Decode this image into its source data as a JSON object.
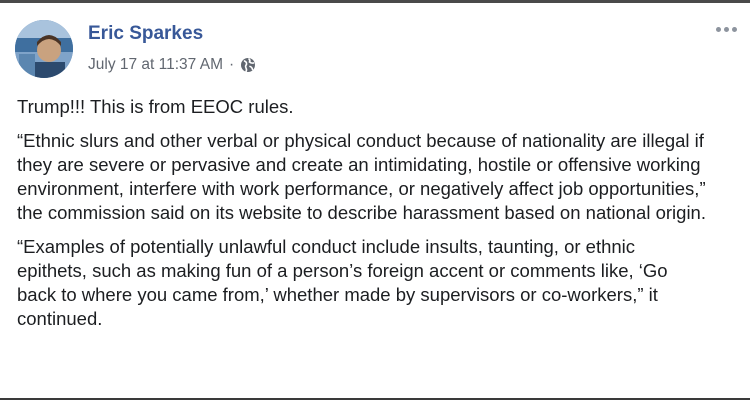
{
  "post": {
    "author": "Eric Sparkes",
    "timestamp": "July 17 at 11:37 AM",
    "separator": "·",
    "privacy_icon": "globe-icon",
    "more_icon": "more-options-icon",
    "paragraphs": [
      "Trump!!! This is from EEOC rules.",
      "“Ethnic slurs and other verbal or physical conduct because of nationality are illegal if they are severe or pervasive and create an intimidating, hostile or offensive working environment, interfere with work performance, or negatively affect job opportunities,” the commission said on its website to describe harassment based on national origin.",
      "“Examples of potentially unlawful conduct include insults, taunting, or ethnic epithets, such as making fun of a person’s foreign accent or comments like, ‘Go back to where you came from,’ whether made by supervisors or co-workers,” it continued."
    ]
  },
  "colors": {
    "author_link": "#385898",
    "meta_text": "#616770",
    "body_text": "#1c1e21"
  }
}
